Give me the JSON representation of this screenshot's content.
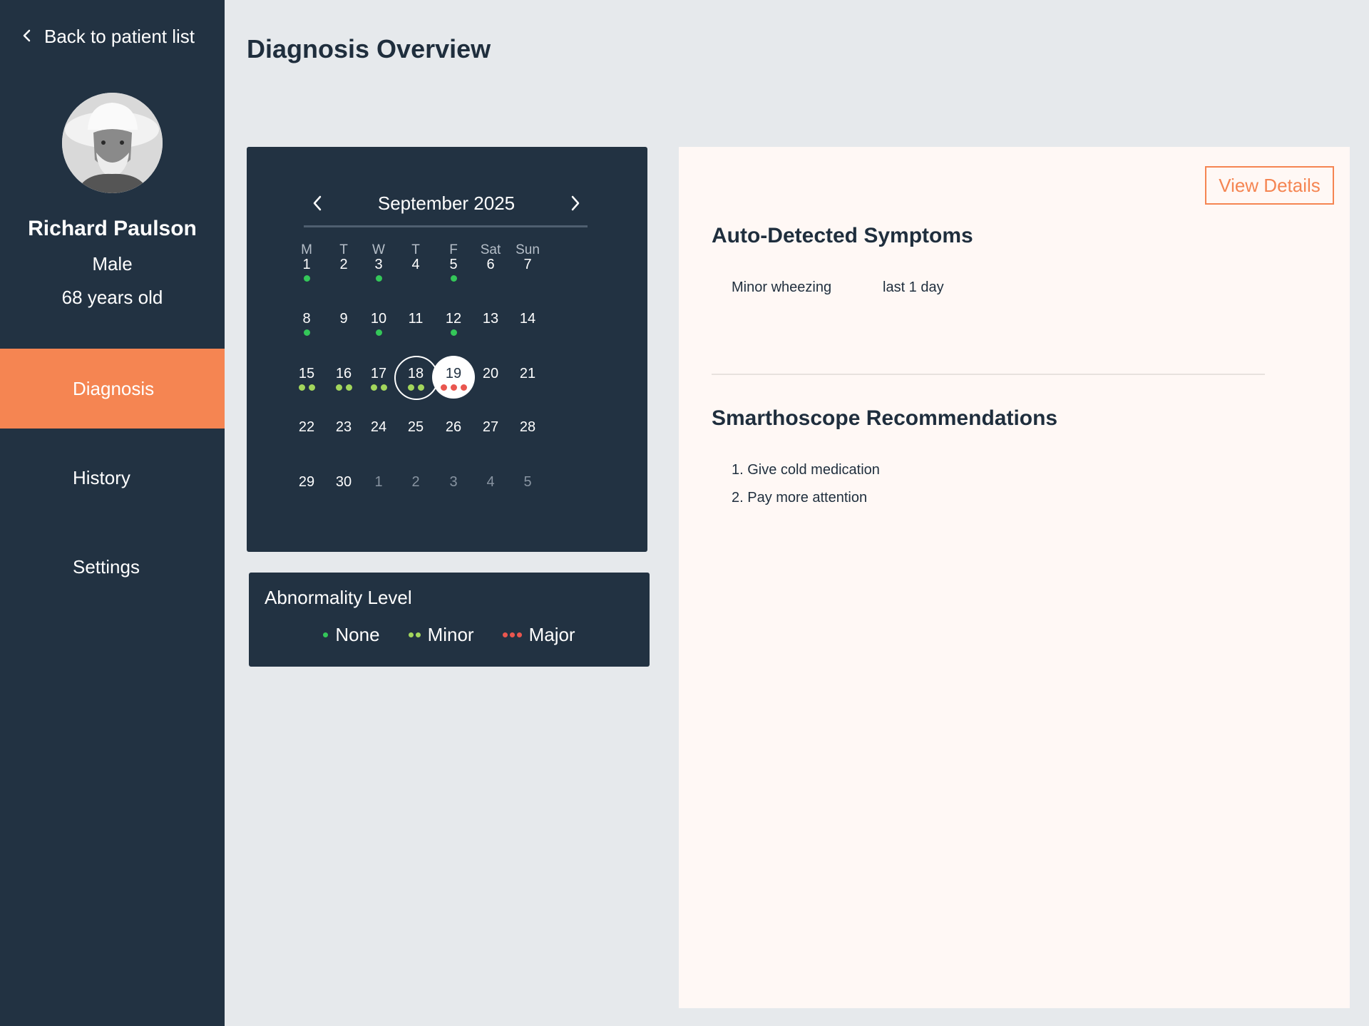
{
  "sidebar": {
    "back_label": "Back to patient list",
    "patient": {
      "name": "Richard Paulson",
      "sex": "Male",
      "age": "68 years old"
    },
    "nav": [
      {
        "label": "Diagnosis",
        "active": true
      },
      {
        "label": "History",
        "active": false
      },
      {
        "label": "Settings",
        "active": false
      }
    ]
  },
  "page_title": "Diagnosis Overview",
  "calendar": {
    "month_label": "September 2025",
    "weekdays": [
      "M",
      "T",
      "W",
      "T",
      "F",
      "Sat",
      "Sun"
    ],
    "weeks": [
      [
        {
          "d": "1",
          "level": "none"
        },
        {
          "d": "2"
        },
        {
          "d": "3",
          "level": "none"
        },
        {
          "d": "4"
        },
        {
          "d": "5",
          "level": "none"
        },
        {
          "d": "6"
        },
        {
          "d": "7"
        }
      ],
      [
        {
          "d": "8",
          "level": "none"
        },
        {
          "d": "9"
        },
        {
          "d": "10",
          "level": "none"
        },
        {
          "d": "11"
        },
        {
          "d": "12",
          "level": "none"
        },
        {
          "d": "13"
        },
        {
          "d": "14"
        }
      ],
      [
        {
          "d": "15",
          "level": "minor"
        },
        {
          "d": "16",
          "level": "minor"
        },
        {
          "d": "17",
          "level": "minor"
        },
        {
          "d": "18",
          "level": "minor",
          "state": "selected"
        },
        {
          "d": "19",
          "level": "major",
          "state": "today"
        },
        {
          "d": "20"
        },
        {
          "d": "21"
        }
      ],
      [
        {
          "d": "22"
        },
        {
          "d": "23"
        },
        {
          "d": "24"
        },
        {
          "d": "25"
        },
        {
          "d": "26"
        },
        {
          "d": "27"
        },
        {
          "d": "28"
        }
      ],
      [
        {
          "d": "29"
        },
        {
          "d": "30"
        },
        {
          "d": "1",
          "muted": true
        },
        {
          "d": "2",
          "muted": true
        },
        {
          "d": "3",
          "muted": true
        },
        {
          "d": "4",
          "muted": true
        },
        {
          "d": "5",
          "muted": true
        }
      ]
    ]
  },
  "legend": {
    "title": "Abnormality Level",
    "items": [
      {
        "label": "None",
        "level": "none"
      },
      {
        "label": "Minor",
        "level": "minor"
      },
      {
        "label": "Major",
        "level": "major"
      }
    ]
  },
  "colors": {
    "none": "#34c759",
    "minor": "#a3d65c",
    "major": "#e9564f",
    "accent": "#f58552",
    "navy": "#223242"
  },
  "panel": {
    "view_details_label": "View Details",
    "symptoms_title": "Auto-Detected Symptoms",
    "symptoms": [
      {
        "name": "Minor wheezing",
        "duration": "last 1 day"
      }
    ],
    "recommendations_title": "Smarthoscope Recommendations",
    "recommendations": [
      "1. Give cold medication",
      "2. Pay more attention"
    ]
  }
}
